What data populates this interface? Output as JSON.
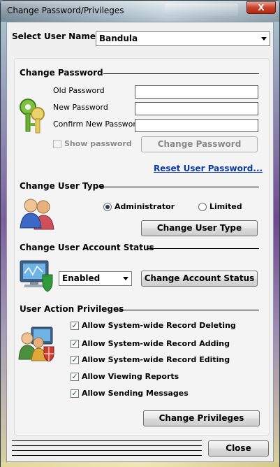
{
  "window": {
    "title": "Change Password/Privileges",
    "close_glyph": "X"
  },
  "user_select": {
    "label": "Select User Name",
    "value": "Bandula"
  },
  "change_password": {
    "title": "Change Password",
    "old_label": "Old Password",
    "new_label": "New Password",
    "confirm_label": "Confirm New Password",
    "show_password_label": "Show password",
    "button_label": "Change Password",
    "reset_link": "Reset User Password..."
  },
  "user_type": {
    "title": "Change User Type",
    "options": [
      "Administrator",
      "Limited"
    ],
    "selected": "Administrator",
    "button_label": "Change User Type"
  },
  "account_status": {
    "title": "Change User Account Status",
    "value": "Enabled",
    "button_label": "Change Account Status"
  },
  "privileges": {
    "title": "User Action Privileges",
    "items": [
      {
        "label": "Allow System-wide Record Deleting",
        "checked": true
      },
      {
        "label": "Allow System-wide Record Adding",
        "checked": true
      },
      {
        "label": "Allow System-wide Record Editing",
        "checked": true
      },
      {
        "label": "Allow Viewing Reports",
        "checked": true
      },
      {
        "label": "Allow Sending Messages",
        "checked": true
      }
    ],
    "button_label": "Change Privileges"
  },
  "footer": {
    "close_label": "Close"
  },
  "icons": [
    "keys-icon",
    "users-icon",
    "monitor-shield-icon",
    "users-shield-icon"
  ]
}
